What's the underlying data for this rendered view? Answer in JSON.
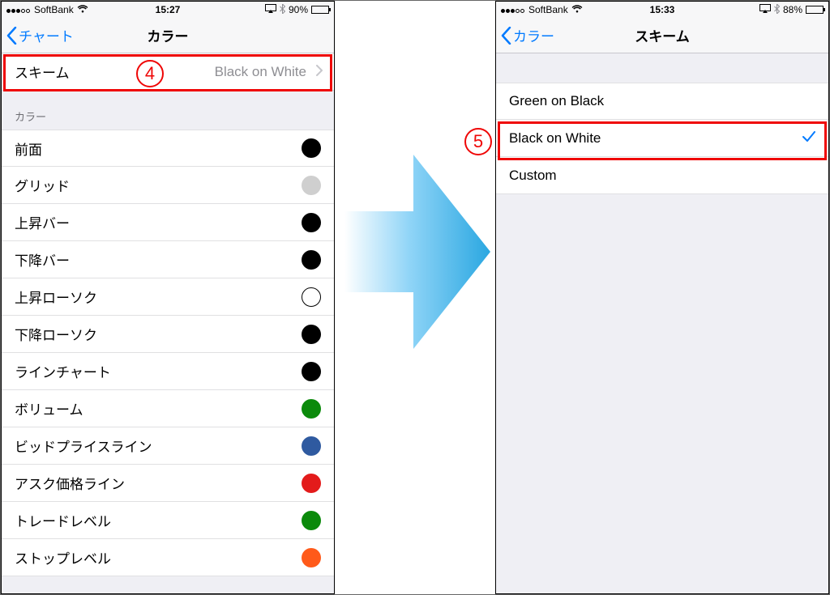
{
  "left_phone": {
    "status": {
      "carrier": "SoftBank",
      "time": "15:27",
      "battery_pct": "90%",
      "battery_fill": 90
    },
    "nav": {
      "back": "チャート",
      "title": "カラー"
    },
    "scheme_row": {
      "label": "スキーム",
      "value": "Black on White"
    },
    "section_header": "カラー",
    "colors": [
      {
        "label": "前面",
        "hex": "#000000"
      },
      {
        "label": "グリッド",
        "hex": "#cfcfcf"
      },
      {
        "label": "上昇バー",
        "hex": "#000000"
      },
      {
        "label": "下降バー",
        "hex": "#000000"
      },
      {
        "label": "上昇ローソク",
        "hex": "#ffffff",
        "stroke": "#000000"
      },
      {
        "label": "下降ローソク",
        "hex": "#000000"
      },
      {
        "label": "ラインチャート",
        "hex": "#000000"
      },
      {
        "label": "ボリューム",
        "hex": "#0b8a0b"
      },
      {
        "label": "ビッドプライスライン",
        "hex": "#2f5aa0"
      },
      {
        "label": "アスク価格ライン",
        "hex": "#e31b1b"
      },
      {
        "label": "トレードレベル",
        "hex": "#0b8a0b"
      },
      {
        "label": "ストップレベル",
        "hex": "#ff5a1a"
      }
    ]
  },
  "right_phone": {
    "status": {
      "carrier": "SoftBank",
      "time": "15:33",
      "battery_pct": "88%",
      "battery_fill": 88
    },
    "nav": {
      "back": "カラー",
      "title": "スキーム"
    },
    "options": [
      {
        "label": "Green on Black",
        "checked": false
      },
      {
        "label": "Black on White",
        "checked": true
      },
      {
        "label": "Custom",
        "checked": false
      }
    ]
  },
  "annotations": {
    "step4": "4",
    "step5": "5"
  }
}
